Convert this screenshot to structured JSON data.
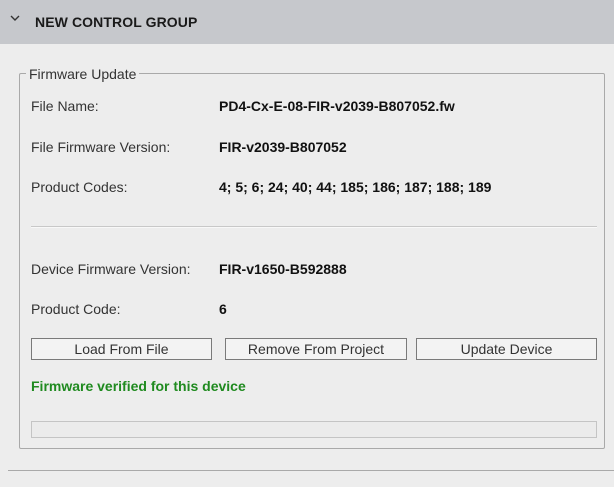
{
  "group": {
    "title": "NEW CONTROL GROUP",
    "expanded": true
  },
  "firmware_update": {
    "legend": "Firmware Update",
    "file_name_label": "File Name:",
    "file_name_value": "PD4-Cx-E-08-FIR-v2039-B807052.fw",
    "file_fw_version_label": "File Firmware Version:",
    "file_fw_version_value": "FIR-v2039-B807052",
    "product_codes_label": "Product Codes:",
    "product_codes_value": "4; 5; 6; 24; 40; 44; 185; 186; 187; 188; 189",
    "device_fw_version_label": "Device Firmware Version:",
    "device_fw_version_value": "FIR-v1650-B592888",
    "product_code_label": "Product Code:",
    "product_code_value": "6",
    "buttons": {
      "load": "Load From File",
      "remove": "Remove From Project",
      "update": "Update Device"
    },
    "status_text": "Firmware verified for this device",
    "status_color": "#1f8a1f",
    "progress_fraction": 0
  },
  "colors": {
    "header_bg": "#c6c8cc",
    "panel_bg": "#ededed",
    "border": "#a9a9a9"
  }
}
